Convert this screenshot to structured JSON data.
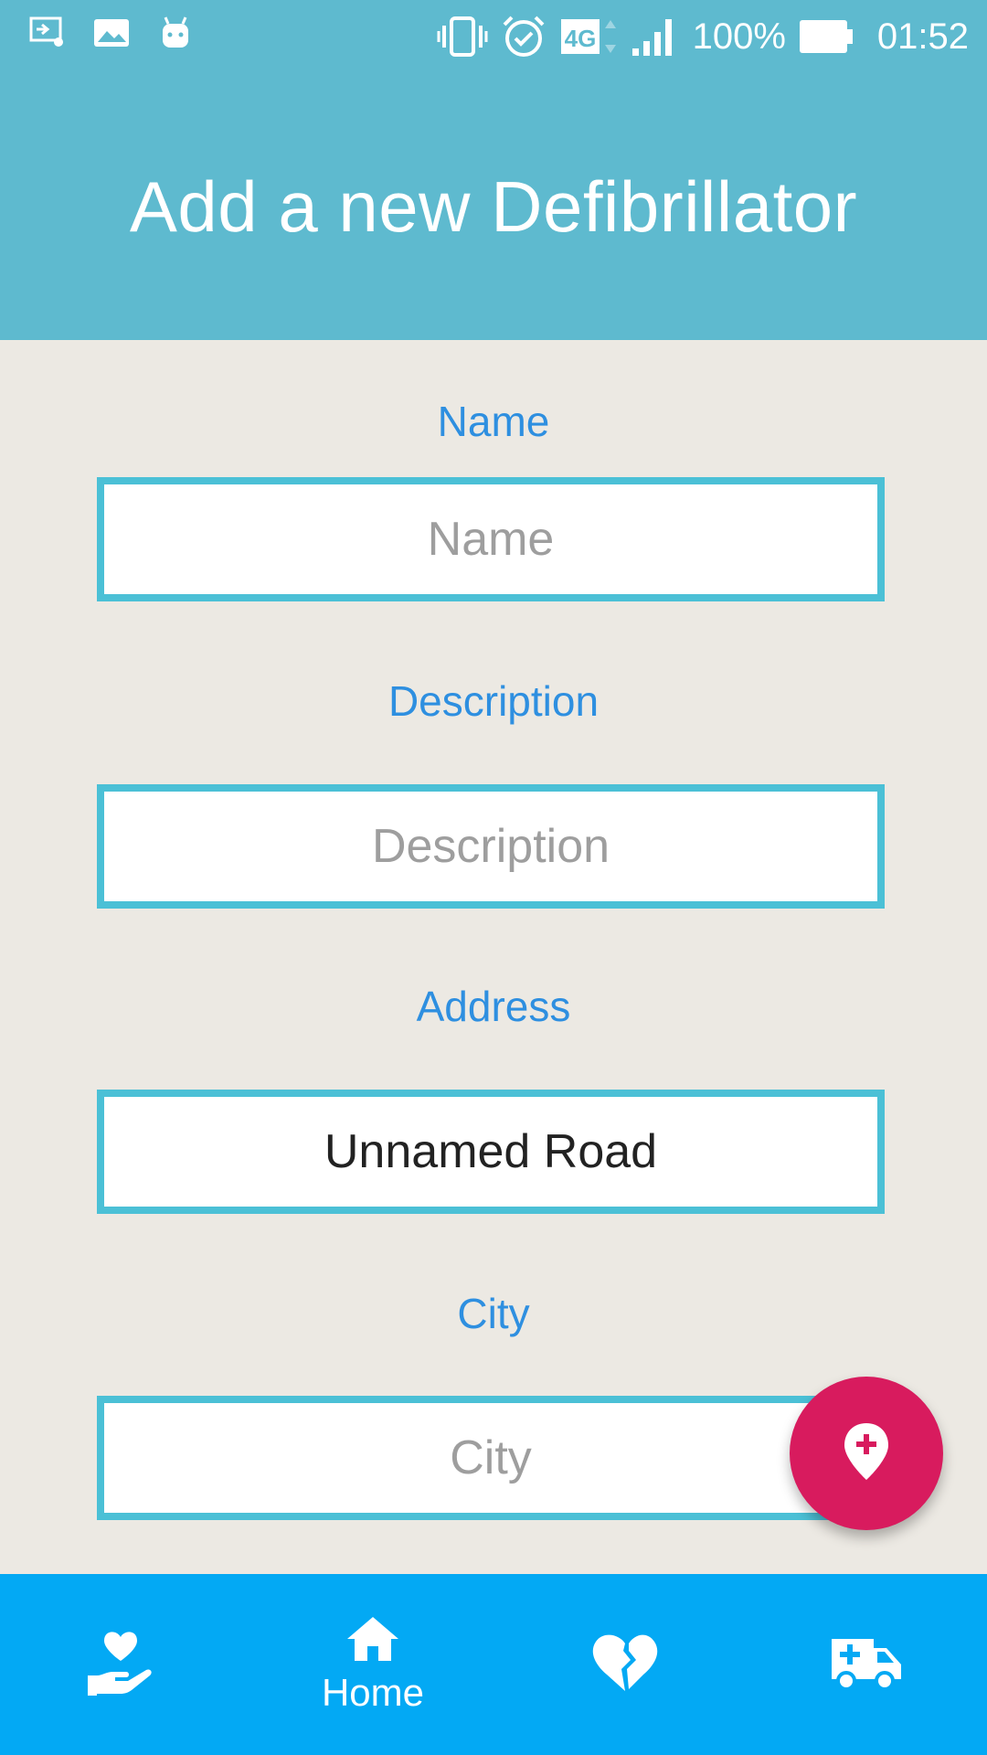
{
  "status_bar": {
    "battery_percent": "100%",
    "time": "01:52",
    "network": "4G",
    "icons": [
      "screencast-icon",
      "image-icon",
      "android-icon",
      "vibrate-icon",
      "alarm-icon",
      "network-4g-icon",
      "signal-icon",
      "battery-icon"
    ]
  },
  "header": {
    "title": "Add a new Defibrillator"
  },
  "form": {
    "name_label": "Name",
    "name_placeholder": "Name",
    "name_value": "",
    "description_label": "Description",
    "description_placeholder": "Description",
    "description_value": "",
    "address_label": "Address",
    "address_value": "Unnamed Road",
    "city_label": "City",
    "city_placeholder": "City",
    "city_value": ""
  },
  "fab": {
    "icon": "add-location-icon"
  },
  "bottom_nav": {
    "items": [
      {
        "icon": "heart-hand-icon",
        "label": ""
      },
      {
        "icon": "home-icon",
        "label": "Home"
      },
      {
        "icon": "broken-heart-icon",
        "label": ""
      },
      {
        "icon": "ambulance-icon",
        "label": ""
      }
    ]
  },
  "colors": {
    "header": "#5EBACF",
    "background": "#ECE9E3",
    "label": "#2E8FE0",
    "field_border": "#4BC0D6",
    "fab": "#D81B5E",
    "bottom_nav": "#03A9F4"
  }
}
